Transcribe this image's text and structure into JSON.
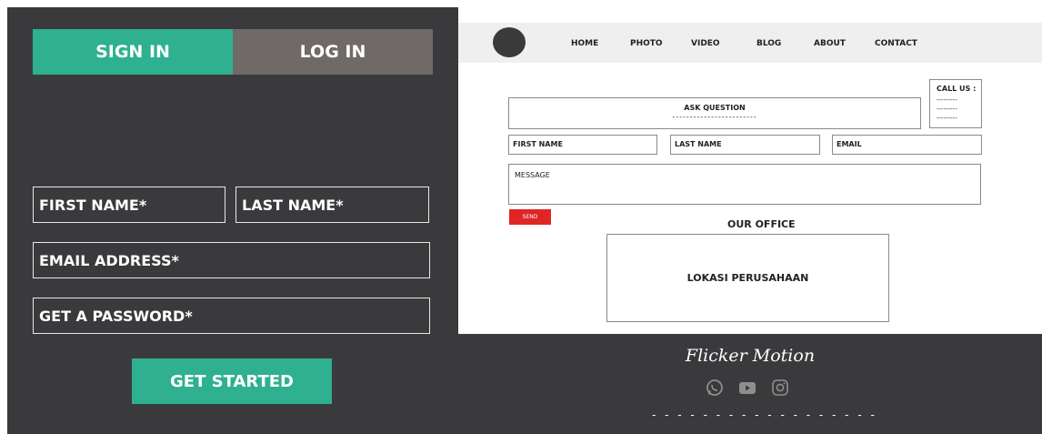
{
  "signup": {
    "tabs": {
      "sign_in": "SIGN IN",
      "log_in": "LOG IN"
    },
    "fields": {
      "first_name": "FIRST NAME*",
      "last_name": "LAST NAME*",
      "email": "EMAIL ADDRESS*",
      "password": "GET A PASSWORD*"
    },
    "submit": "GET STARTED",
    "colors": {
      "accent": "#2fb090",
      "inactive_tab": "#6f6a68",
      "background": "#3a3a3d"
    }
  },
  "website": {
    "nav": [
      "HOME",
      "PHOTO",
      "VIDEO",
      "BLOG",
      "ABOUT",
      "CONTACT"
    ],
    "ask_question": {
      "label": "ASK QUESTION",
      "dashes": "------------------------"
    },
    "call_us": {
      "label": "CALL US :",
      "lines": [
        "---------",
        "---------",
        "---------"
      ]
    },
    "form": {
      "first_name": "FIRST NAME",
      "last_name": "LAST NAME",
      "email": "EMAIL",
      "message": "MESSAGE",
      "send": "SEND"
    },
    "office": {
      "title": "OUR OFFICE",
      "location": "LOKASI PERUSAHAAN"
    },
    "footer": {
      "brand": "Flicker Motion",
      "social_icons": [
        "whatsapp-icon",
        "youtube-icon",
        "instagram-icon"
      ],
      "dashes": "- - - - - - - - - - - - - - - - - -"
    },
    "colors": {
      "send_button": "#e02525",
      "navbar": "#efefef",
      "footer": "#3a3a3d"
    }
  }
}
